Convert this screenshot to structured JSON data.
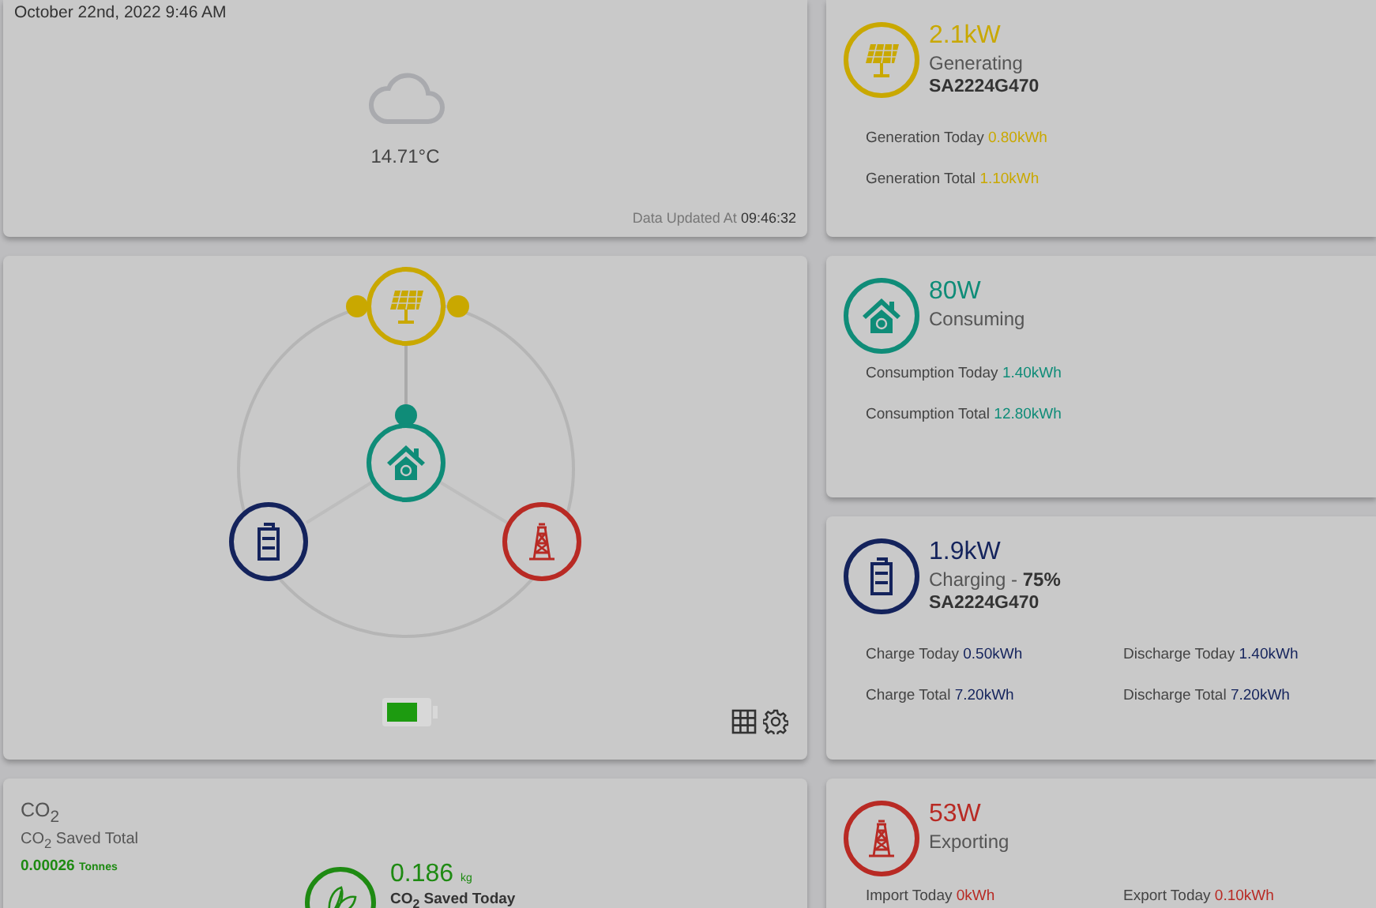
{
  "weather": {
    "datetime": "October 22nd, 2022 9:46 AM",
    "temperature": "14.71°C",
    "updated_label": "Data Updated At",
    "updated_time": "09:46:32"
  },
  "flow": {
    "battery_indicator": {
      "level": 0.78
    }
  },
  "cards": [
    {
      "kind": "solar",
      "color": "#c9a800",
      "power": "2.1kW",
      "status": "Generating",
      "serial": "SA2224G470",
      "rows": [
        [
          {
            "label": "Generation Today",
            "value": "0.80kWh"
          }
        ],
        [
          {
            "label": "Generation Total",
            "value": "1.10kWh"
          }
        ]
      ]
    },
    {
      "kind": "home",
      "color": "#0f8c78",
      "power": "80W",
      "status": "Consuming",
      "rows": [
        [
          {
            "label": "Consumption Today",
            "value": "1.40kWh"
          }
        ],
        [
          {
            "label": "Consumption Total",
            "value": "12.80kWh"
          }
        ]
      ]
    },
    {
      "kind": "battery",
      "color": "#14235c",
      "power": "1.9kW",
      "status": "Charging - **75%**",
      "serial": "SA2224G470",
      "rows": [
        [
          {
            "label": "Charge Today",
            "value": "0.50kWh"
          },
          {
            "label": "Discharge Today",
            "value": "1.40kWh"
          }
        ],
        [
          {
            "label": "Charge Total",
            "value": "7.20kWh"
          },
          {
            "label": "Discharge Total",
            "value": "7.20kWh"
          }
        ]
      ]
    },
    {
      "kind": "grid",
      "color": "#b82a24",
      "power": "53W",
      "status": "Exporting",
      "rows": [
        [
          {
            "label": "Import Today",
            "value": "0kWh"
          },
          {
            "label": "Export Today",
            "value": "0.10kWh"
          }
        ]
      ]
    }
  ],
  "co2": {
    "title": "CO$_{2}$",
    "total_label": "CO$_{2}$ Saved Total",
    "total_value": "0.00026",
    "total_unit": "Tonnes",
    "today_value": "0.186",
    "today_unit": "kg",
    "today_label": "CO$_{2}$ Saved Today"
  }
}
